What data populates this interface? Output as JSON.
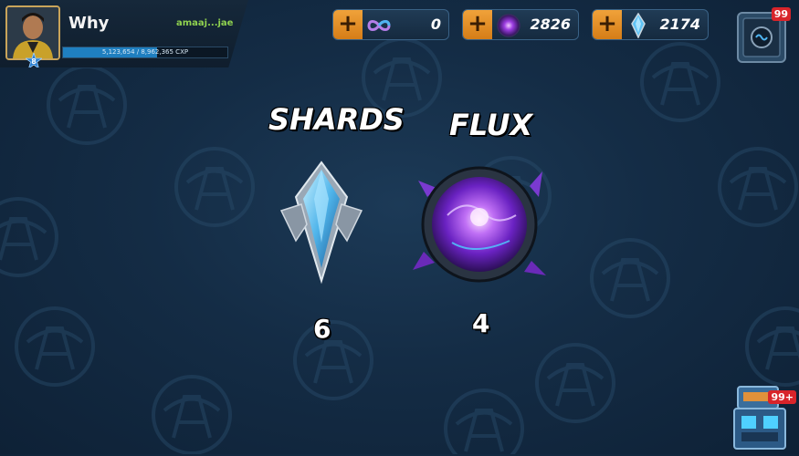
{
  "player": {
    "name": "Why",
    "tag": "amaaj...jae",
    "level": "8",
    "xp_text": "5,123,654 / 8,962,365 CXP",
    "xp_progress": 0.57
  },
  "currencies": [
    {
      "icon": "infinity-icon",
      "value": "0"
    },
    {
      "icon": "flux-orb-icon",
      "value": "2826"
    },
    {
      "icon": "shard-crystal-icon",
      "value": "2174"
    }
  ],
  "chest_top": {
    "badge": "99"
  },
  "chest_bottom": {
    "badge": "99+"
  },
  "resources": {
    "shards": {
      "title": "SHARDS",
      "count": "6"
    },
    "flux": {
      "title": "FLUX",
      "count": "4"
    }
  },
  "colors": {
    "accent_orange": "#f0a23a",
    "xp_bar": "#1f7fc0",
    "tag_green": "#8fd14f",
    "badge_red": "#d8242a"
  }
}
